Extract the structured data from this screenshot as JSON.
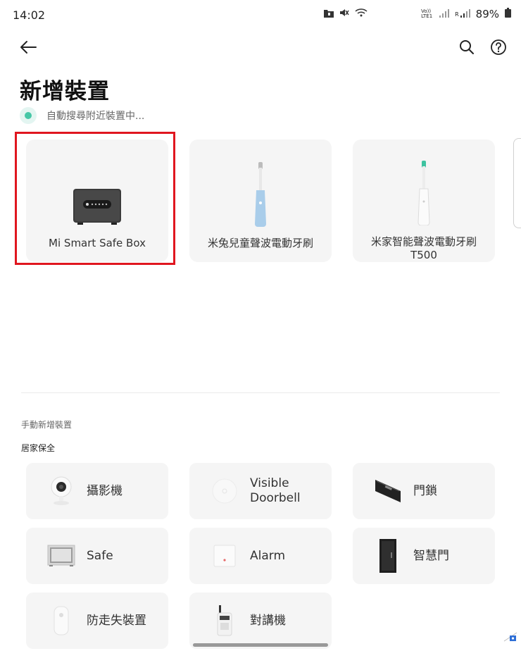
{
  "status_bar": {
    "time": "14:02",
    "lte_label": "Vo)) LTE1",
    "r_label": "R",
    "battery": "89%"
  },
  "header": {
    "title": "新增裝置",
    "scan_status": "自動搜尋附近裝置中..."
  },
  "discovered": [
    {
      "label": "Mi Smart Safe Box",
      "icon": "safe-box-image"
    },
    {
      "label": "米兔兒童聲波電動牙刷",
      "icon": "toothbrush-blue-image"
    },
    {
      "label": "米家智能聲波電動牙刷 T500",
      "icon": "toothbrush-white-image"
    }
  ],
  "manual": {
    "section_title": "手動新增裝置",
    "category": "居家保全",
    "items": [
      {
        "label": "攝影機",
        "icon": "camera-icon"
      },
      {
        "label": "Visible Doorbell",
        "icon": "doorbell-icon"
      },
      {
        "label": "門鎖",
        "icon": "door-lock-icon"
      },
      {
        "label": "Safe",
        "icon": "safe-icon"
      },
      {
        "label": "Alarm",
        "icon": "alarm-icon"
      },
      {
        "label": "智慧門",
        "icon": "smart-door-icon"
      },
      {
        "label": "防走失裝置",
        "icon": "anti-loss-icon"
      },
      {
        "label": "對講機",
        "icon": "walkie-talkie-icon"
      }
    ]
  },
  "colors": {
    "accent": "#46c7a6",
    "highlight": "#e0161f",
    "card_bg": "#f5f5f5"
  }
}
